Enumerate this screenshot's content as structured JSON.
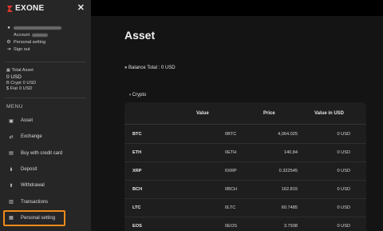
{
  "brand": {
    "name": "EXONE",
    "accent": "#e0352b"
  },
  "sidebar": {
    "close_icon": "close-icon",
    "account_label": "Account",
    "personal_setting": "Personal setting",
    "sign_out": "Sign out",
    "total_asset_label": "Total Asset",
    "total_asset_value": "0 USD",
    "crypto_label": "B Crypt",
    "crypto_value": "0 USD",
    "fiat_label": "$ Fiat",
    "fiat_value": "0 USD",
    "menu_title": "MENU",
    "items": [
      {
        "label": "Asset",
        "icon": "wallet-icon"
      },
      {
        "label": "Exchange",
        "icon": "exchange-icon"
      },
      {
        "label": "Buy with credit card",
        "icon": "cart-icon"
      },
      {
        "label": "Deposit",
        "icon": "deposit-icon"
      },
      {
        "label": "Withdrawal",
        "icon": "withdrawal-icon"
      },
      {
        "label": "Transactions",
        "icon": "chart-icon"
      },
      {
        "label": "Personal setting",
        "icon": "calendar-icon"
      }
    ],
    "highlight_color": "#f08a1a"
  },
  "main": {
    "title": "Asset",
    "balance_text": "Balance Total : 0 USD",
    "crypto_section": "Crypto",
    "table": {
      "headers": {
        "value": "Value",
        "price": "Price",
        "value_usd": "Value in USD"
      },
      "rows": [
        {
          "symbol": "BTC",
          "value": "0BTC",
          "price": "4,064.025",
          "usd": "0 USD"
        },
        {
          "symbol": "ETH",
          "value": "0ETH",
          "price": "140.84",
          "usd": "0 USD"
        },
        {
          "symbol": "XRP",
          "value": "0XRP",
          "price": "0.322545",
          "usd": "0 USD"
        },
        {
          "symbol": "BCH",
          "value": "0BCH",
          "price": "162.815",
          "usd": "0 USD"
        },
        {
          "symbol": "LTC",
          "value": "0LTC",
          "price": "60.7485",
          "usd": "0 USD"
        },
        {
          "symbol": "EOS",
          "value": "0EOS",
          "price": "3.7938",
          "usd": "0 USD"
        }
      ]
    }
  }
}
